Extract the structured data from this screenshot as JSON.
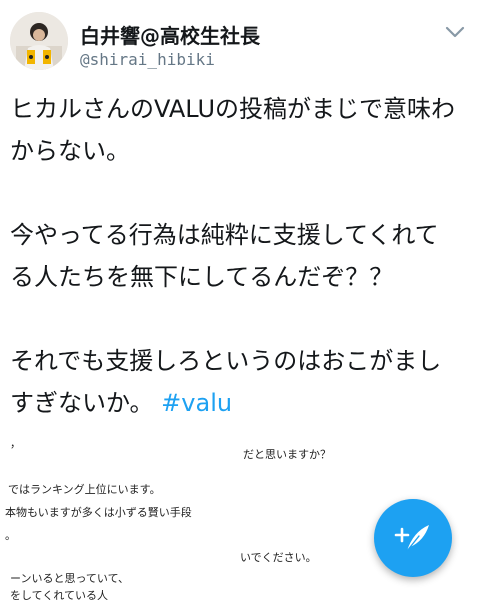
{
  "tweet": {
    "display_name": "白井響@高校生社長",
    "handle": "@shirai_hibiki",
    "text_lines": [
      "ヒカルさんのVALUの投稿がまじで意味わ",
      "からない。",
      "",
      "今やってる行為は純粋に支援してくれて",
      "る人たちを無下にしてるんだぞ？？",
      "",
      "それでも支援しろというのはおこがまし",
      "すぎないか。"
    ],
    "hashtag": "#valu"
  },
  "media_text": {
    "line1_left": "，",
    "line1_right": "だと思いますか？",
    "line2": "ではランキング上位にいます。",
    "line3": "本物もいますが多くは小ずる賢い手段",
    "line4": "。",
    "line5_right": "いでください。",
    "line6": "ーンいると思っていて、",
    "line7": "をしてくれている人"
  },
  "icons": {
    "caret": "chevron-down-icon",
    "compose": "compose-tweet-icon"
  },
  "colors": {
    "accent": "#1da1f2",
    "text": "#14171a",
    "secondary": "#657786"
  }
}
